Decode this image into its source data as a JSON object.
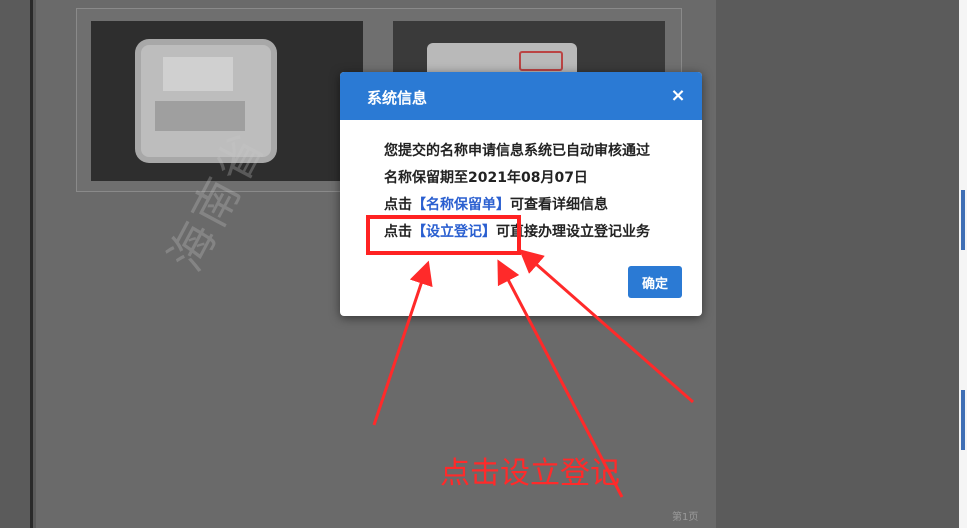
{
  "background": {
    "watermark_text": "海南省",
    "page_number": "第1页"
  },
  "modal": {
    "title": "系统信息",
    "close_icon": "×",
    "lines": [
      {
        "pre": "您提交的名称申请信息系统已自动审核通过",
        "link": "",
        "post": ""
      },
      {
        "pre": "名称保留期至2021年08月07日",
        "link": "",
        "post": ""
      },
      {
        "pre": "点击",
        "link": "【名称保留单】",
        "post": "可查看详细信息"
      },
      {
        "pre": "点击",
        "link": "【设立登记】",
        "post": "可直接办理设立登记业务"
      }
    ],
    "ok_label": "确定"
  },
  "annotation": {
    "text": "点击设立登记",
    "color": "#ff2a2a"
  },
  "colors": {
    "accent": "#2b7ad4",
    "link": "#2a5fd0",
    "highlight": "#ff2222"
  },
  "icons": {
    "close": "close-icon"
  }
}
